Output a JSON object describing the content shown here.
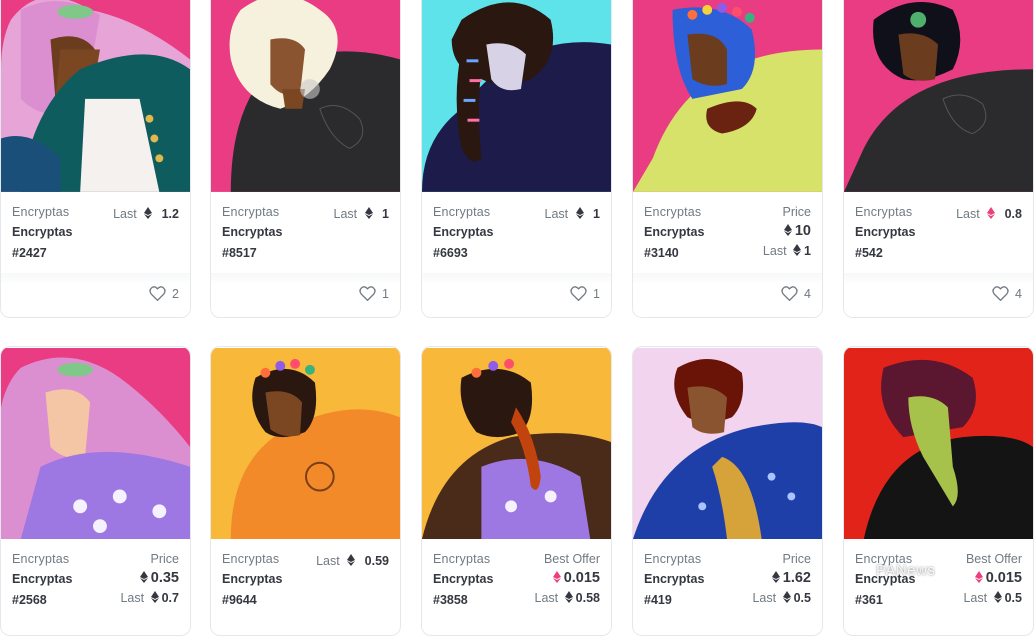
{
  "row1": [
    {
      "collection": "Encryptas",
      "name": "Encryptas",
      "id": "#2427",
      "mode": "last",
      "last_label": "Last",
      "last_value": "1.2",
      "likes": "2"
    },
    {
      "collection": "Encryptas",
      "name": "Encryptas",
      "id": "#8517",
      "mode": "last",
      "last_label": "Last",
      "last_value": "1",
      "likes": "1"
    },
    {
      "collection": "Encryptas",
      "name": "Encryptas",
      "id": "#6693",
      "mode": "last",
      "last_label": "Last",
      "last_value": "1",
      "likes": "1"
    },
    {
      "collection": "Encryptas",
      "name": "Encryptas",
      "id": "#3140",
      "mode": "price",
      "price_label": "Price",
      "price_value": "10",
      "last_label": "Last",
      "last_value": "1",
      "likes": "4"
    },
    {
      "collection": "Encryptas",
      "name": "Encryptas",
      "id": "#542",
      "mode": "last",
      "last_label": "Last",
      "last_value": "0.8",
      "likes": "4"
    }
  ],
  "row2": [
    {
      "collection": "Encryptas",
      "name": "Encryptas",
      "id": "#2568",
      "mode": "price",
      "price_label": "Price",
      "price_value": "0.35",
      "last_label": "Last",
      "last_value": "0.7"
    },
    {
      "collection": "Encryptas",
      "name": "Encryptas",
      "id": "#9644",
      "mode": "last",
      "last_label": "Last",
      "last_value": "0.59"
    },
    {
      "collection": "Encryptas",
      "name": "Encryptas",
      "id": "#3858",
      "mode": "price",
      "price_label": "Best Offer",
      "price_value": "0.015",
      "last_label": "Last",
      "last_value": "0.58"
    },
    {
      "collection": "Encryptas",
      "name": "Encryptas",
      "id": "#419",
      "mode": "price",
      "price_label": "Price",
      "price_value": "1.62",
      "last_label": "Last",
      "last_value": "0.5"
    },
    {
      "collection": "Encryptas",
      "name": "Encryptas",
      "id": "#361",
      "mode": "price",
      "price_label": "Best Offer",
      "price_value": "0.015",
      "last_label": "Last",
      "last_value": "0.5"
    }
  ],
  "watermark": "PANews",
  "colors": {
    "eth": "#353840",
    "weth": "#ec407a",
    "text_muted": "#707a83",
    "text_dark": "#353840"
  },
  "icons": {
    "currency": "eth-icon",
    "offer_currency": "weth-icon",
    "like": "heart-icon"
  }
}
